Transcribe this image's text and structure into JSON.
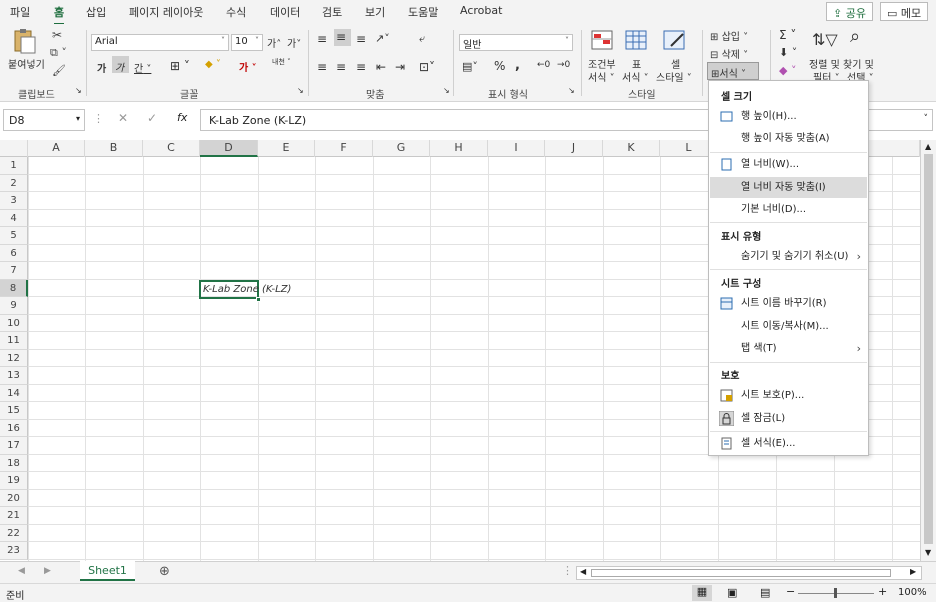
{
  "tabs": [
    "파일",
    "홈",
    "삽입",
    "페이지 레이아웃",
    "수식",
    "데이터",
    "검토",
    "보기",
    "도움말",
    "Acrobat"
  ],
  "top_buttons": {
    "share": "공유",
    "memo": "메모"
  },
  "ribbon": {
    "clipboard": {
      "paste": "붙여넣기",
      "label": "클립보드"
    },
    "font": {
      "name": "Arial",
      "size": "10",
      "label": "글꼴",
      "grow": "가",
      "shrink": "가",
      "bold": "가",
      "italic": "가",
      "underline": "간",
      "color_char": "가",
      "phonetic": "내천"
    },
    "alignment": {
      "label": "맞춤"
    },
    "number": {
      "format": "일반",
      "label": "표시 형식"
    },
    "styles": {
      "conditional": "조건부\n서식",
      "cond1": "조건부",
      "cond2": "서식",
      "table1": "표",
      "table2": "서식",
      "cell1": "셀",
      "cell2": "스타일",
      "label": "스타일"
    },
    "cells": {
      "insert": "삽입",
      "delete": "삭제",
      "format": "서식"
    },
    "editing": {
      "sort1": "정렬 및",
      "sort2": "필터",
      "find1": "찾기 및",
      "find2": "선택"
    }
  },
  "formula_bar": {
    "name_box": "D8",
    "fx": "fx",
    "value": "K-Lab Zone (K-LZ)"
  },
  "columns": [
    "A",
    "B",
    "C",
    "D",
    "E",
    "F",
    "G",
    "H",
    "I",
    "J",
    "K",
    "L"
  ],
  "rows": [
    "1",
    "2",
    "3",
    "4",
    "5",
    "6",
    "7",
    "8",
    "9",
    "10",
    "11",
    "12",
    "13",
    "14",
    "15",
    "16",
    "17",
    "18",
    "19",
    "20",
    "21",
    "22",
    "23"
  ],
  "cell_D8": "K-Lab Zone (K-LZ)",
  "sheet_tab": "Sheet1",
  "status": {
    "ready": "준비",
    "zoom": "100%"
  },
  "menu": {
    "h1": "셀 크기",
    "row_height": "행 높이(H)...",
    "autofit_row": "행 높이 자동 맞춤(A)",
    "col_width": "열 너비(W)...",
    "autofit_col": "열 너비 자동 맞춤(I)",
    "default_width": "기본 너비(D)...",
    "h2": "표시 유형",
    "hide_unhide": "숨기기 및 숨기기 취소(U)",
    "h3": "시트 구성",
    "rename": "시트 이름 바꾸기(R)",
    "move_copy": "시트 이동/복사(M)...",
    "tab_color": "탭 색(T)",
    "h4": "보호",
    "protect": "시트 보호(P)...",
    "lock": "셀 잠금(L)",
    "format_cells": "셀 서식(E)..."
  },
  "colors": {
    "accent": "#1e6e3e",
    "highlight": "#dcdcdc",
    "selection": "#217346"
  }
}
